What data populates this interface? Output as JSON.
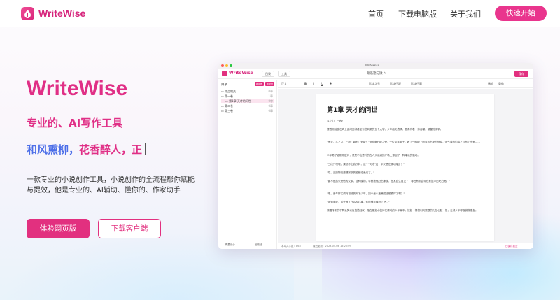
{
  "header": {
    "logo_text": "WriteWise",
    "nav": [
      "首页",
      "下载电脑版",
      "关于我们"
    ],
    "cta": "快速开始"
  },
  "hero": {
    "title": "WriteWise",
    "subtitle": "专业的、AI写作工具",
    "typing_part1": "和风熏柳，",
    "typing_part2": "花香醉人，",
    "typing_part3": "正",
    "description": "一款专业的小说创作工具，小说创作的全流程帮你赋能与提效，他是专业的、AI辅助、懂你的、作家助手",
    "primary_button": "体验网页版",
    "secondary_button": "下载客户端"
  },
  "app": {
    "window_title": "WriteWise",
    "logo_text": "WriteWise",
    "tab_1": "目录",
    "tab_2": "工具",
    "doc_title": "斯洛德与微 ✎",
    "save_button": "保存",
    "sidebar": {
      "heading": "目录",
      "btn_1": "新建卷",
      "btn_2": "新建章",
      "items": [
        {
          "label": "作品相关",
          "count": "0章"
        },
        {
          "label": "第一卷",
          "count": "1章"
        },
        {
          "label": "第1章 天才的问世",
          "count": "0字"
        },
        {
          "label": "第二卷",
          "count": "0章"
        },
        {
          "label": "第三卷",
          "count": "0章"
        }
      ],
      "footer_left": "概要设计",
      "footer_right": "回收站"
    },
    "toolbar": [
      "正文",
      "B",
      "I",
      "U",
      "S",
      "默认字号",
      "默认行距",
      "默认行高",
      "撤销",
      "重做"
    ],
    "chapter_title": "第1章 天才的问世",
    "paragraphs": [
      "斗之力，三段！",
      "望着测验魔石碑上面闪亮得甚至有些刺眼的五个大字，少年面无表情，唇角有着一抹自嘲，紧握的手掌。",
      "\"萧炎，斗之力，三段！级别：低级！\"测验魔石碑之旁，一位中年男子，看了一眼碑上所显示出来的信息，语气漠然的将之公布了出来……",
      "中年男子话刚刚脱口，便是不出意外的在人头汹涌的广场上带起了一阵嘲讽的骚动。",
      "\"三段？嘿嘿，果然不出我所料，这个\"天才\"这一年又是在原地踏步！\"",
      "\"哎，这废物真是把家族的脸都给丢光了。\"",
      "\"要不是族长是他的父亲，这种废物，早就被驱赶出家族，任其自生自灭了，哪还有机会待在家族中白吃白喝。\"",
      "\"唉，昔年那名闻乌坦城的天才少年，如今怎么落魄成这般模样了啊？\"",
      "\"谁知道呢，或许做了什么亏心事，惹得神灵降怒了吧…\"",
      "周围传来的不屑讥笑以及惋惜轻叹，落在那如木桩待在原地的少年耳中，恍如一根根利刺狠狠的扎在心脏一般，让得少年呼吸微微急促。"
    ],
    "status_left": "本章共字数：863",
    "status_mid": "最近更新：2023-05-08 15:25:09",
    "status_right": "已保存到云"
  },
  "colors": {
    "brand": "#e2307f",
    "accent_blue": "#4c6ee8"
  }
}
